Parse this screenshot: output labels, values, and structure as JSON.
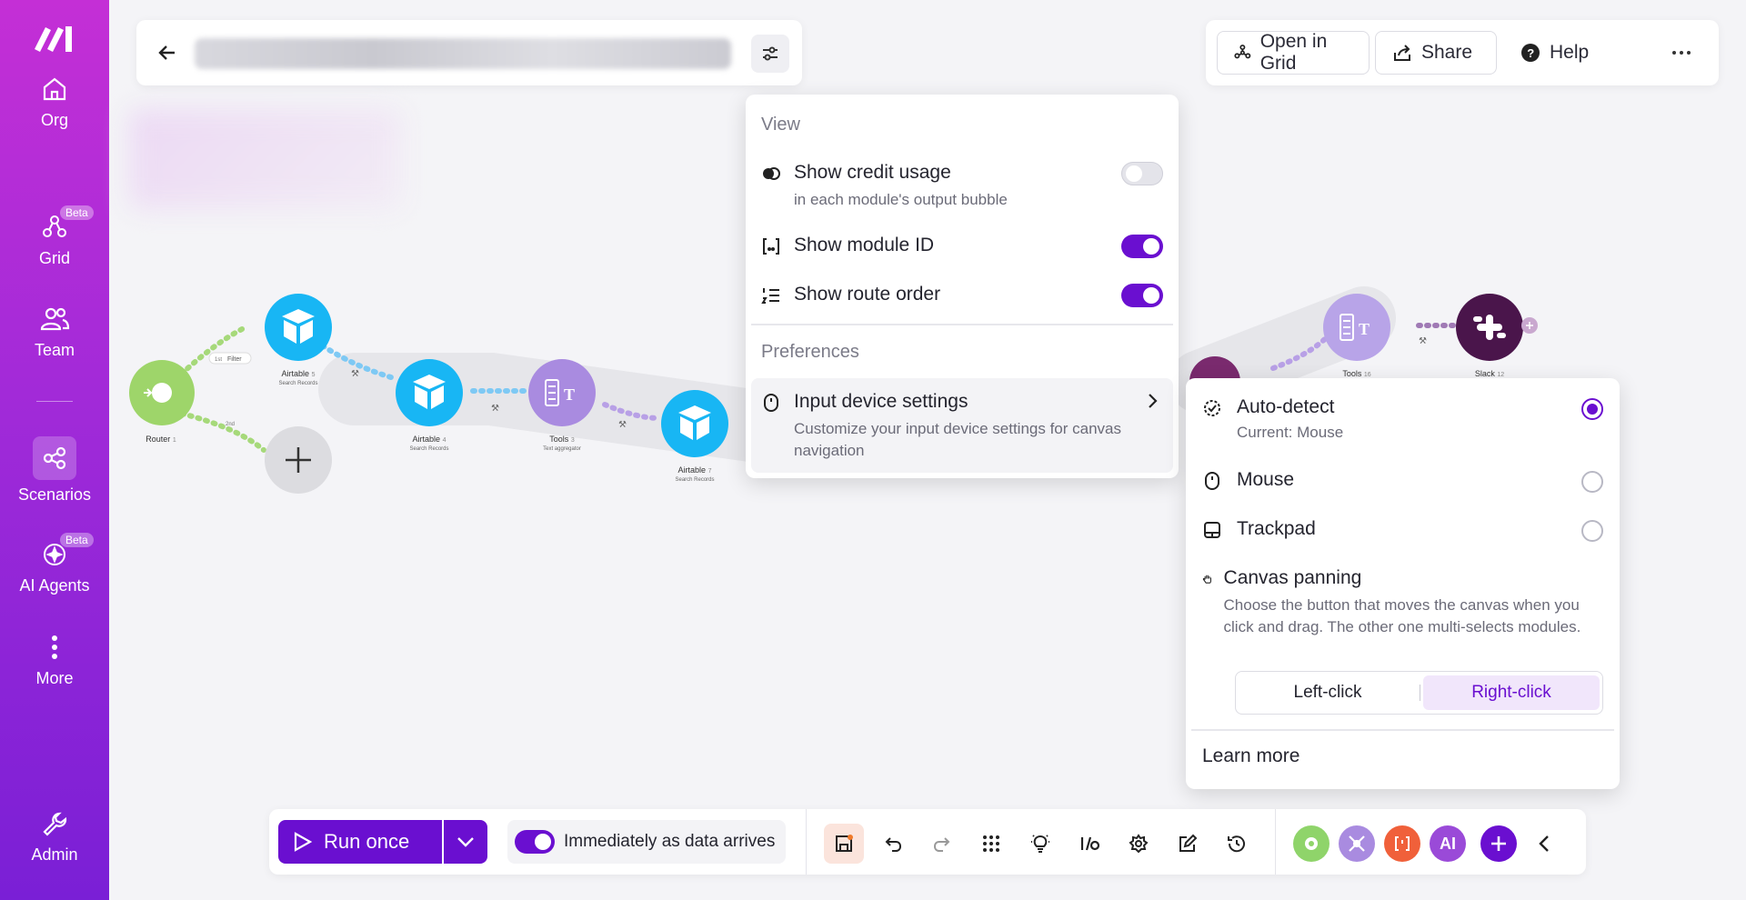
{
  "sidebar": {
    "items": [
      {
        "label": "Org",
        "icon": "home-icon"
      },
      {
        "label": "Grid",
        "icon": "grid-graph-icon",
        "badge": "Beta"
      },
      {
        "label": "Team",
        "icon": "team-icon"
      },
      {
        "label": "Scenarios",
        "icon": "scenarios-icon"
      },
      {
        "label": "AI Agents",
        "icon": "ai-agents-icon",
        "badge": "Beta"
      },
      {
        "label": "More",
        "icon": "more-vertical-icon"
      },
      {
        "label": "Admin",
        "icon": "wrench-icon"
      }
    ]
  },
  "header": {
    "open_in_grid": "Open in Grid",
    "share": "Share",
    "help": "Help"
  },
  "canvas": {
    "nodes": [
      {
        "label": "Router",
        "num": "1"
      },
      {
        "label": "Airtable",
        "num": "5",
        "sub": "Search Records"
      },
      {
        "label": "Airtable",
        "num": "4",
        "sub": "Search Records"
      },
      {
        "label": "Tools",
        "num": "3",
        "sub": "Text aggregator"
      },
      {
        "label": "Airtable",
        "num": "7",
        "sub": "Search Records"
      },
      {
        "label": "Tools",
        "num": "16"
      },
      {
        "label": "Slack",
        "num": "12"
      }
    ],
    "filter_label": "Filter",
    "route_1": "1st",
    "route_2": "2nd"
  },
  "menu": {
    "view_section": "View",
    "credit_label": "Show credit usage",
    "credit_sub": "in each module's output bubble",
    "module_id_label": "Show module ID",
    "route_order_label": "Show route order",
    "preferences_section": "Preferences",
    "input_label": "Input device settings",
    "input_sub": "Customize your input device settings for canvas navigation",
    "toggles": {
      "credit": false,
      "module_id": true,
      "route_order": true
    }
  },
  "submenu": {
    "auto_label": "Auto-detect",
    "auto_sub": "Current: Mouse",
    "mouse_label": "Mouse",
    "trackpad_label": "Trackpad",
    "panning_label": "Canvas panning",
    "panning_sub": "Choose the button that moves the canvas when you click and drag. The other one multi-selects modules.",
    "left_click": "Left-click",
    "right_click": "Right-click",
    "learn_more": "Learn more",
    "selected": "Auto-detect",
    "panning_selected": "Right-click"
  },
  "toolbar": {
    "run_once": "Run once",
    "schedule": "Immediately as data arrives",
    "schedule_on": true,
    "ai_badge": "AI"
  },
  "colors": {
    "accent": "#6a0fd0",
    "airtable": "#18b6f4",
    "router": "#9ed56a",
    "tools": "#a98be0",
    "slack": "#4a154b"
  }
}
